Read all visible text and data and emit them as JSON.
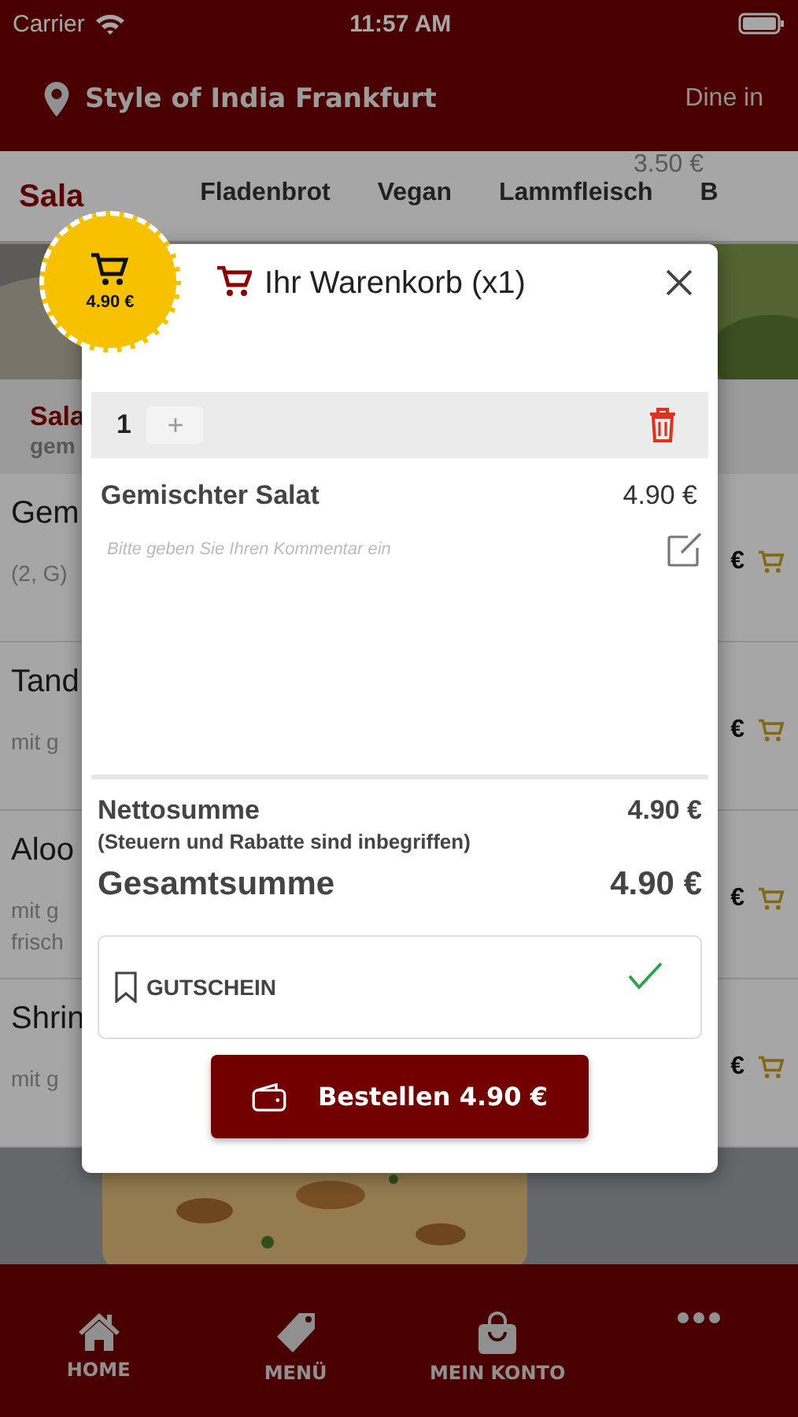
{
  "status_bar": {
    "carrier": "Carrier",
    "time": "11:57 AM"
  },
  "header": {
    "location": "Style of India Frankfurt",
    "mode": "Dine in"
  },
  "ghost_price": "3.50 €",
  "tabs": [
    {
      "label": "Sala",
      "selected": true
    },
    {
      "label": "Fladenbrot",
      "selected": false
    },
    {
      "label": "Vegan",
      "selected": false
    },
    {
      "label": "Lammfleisch",
      "selected": false
    },
    {
      "label": "B",
      "selected": false
    }
  ],
  "section": {
    "title": "Sala",
    "subtitle": "gem"
  },
  "menu_items": [
    {
      "name": "Gem",
      "description": [
        "(2, G)"
      ],
      "price": "€"
    },
    {
      "name": "Tand",
      "description": [
        "mit g"
      ],
      "price": "€"
    },
    {
      "name": "Aloo",
      "description": [
        "mit g",
        "frisch"
      ],
      "price": "€"
    },
    {
      "name": "Shrin",
      "description": [
        "mit g"
      ],
      "price": "€"
    }
  ],
  "cart_badge": {
    "total": "4.90 €"
  },
  "cart": {
    "title": "Ihr Warenkorb (x1)",
    "items": [
      {
        "quantity": "1",
        "plus": "+",
        "name": "Gemischter Salat",
        "price": "4.90 €",
        "comment_placeholder": "Bitte geben Sie Ihren Kommentar ein"
      }
    ],
    "net_label": "Nettosumme",
    "net_note": "(Steuern und Rabatte sind inbegriffen)",
    "net_value": "4.90 €",
    "total_label": "Gesamtsumme",
    "total_value": "4.90 €",
    "voucher": {
      "label": "GUTSCHEIN",
      "applied": true
    },
    "order_button": "Bestellen 4.90 €"
  },
  "nav": [
    {
      "label": "HOME",
      "kind": "home"
    },
    {
      "label": "MENÜ",
      "kind": "tag"
    },
    {
      "label": "MEIN KONTO",
      "kind": "bag"
    },
    {
      "kind": "more"
    }
  ]
}
